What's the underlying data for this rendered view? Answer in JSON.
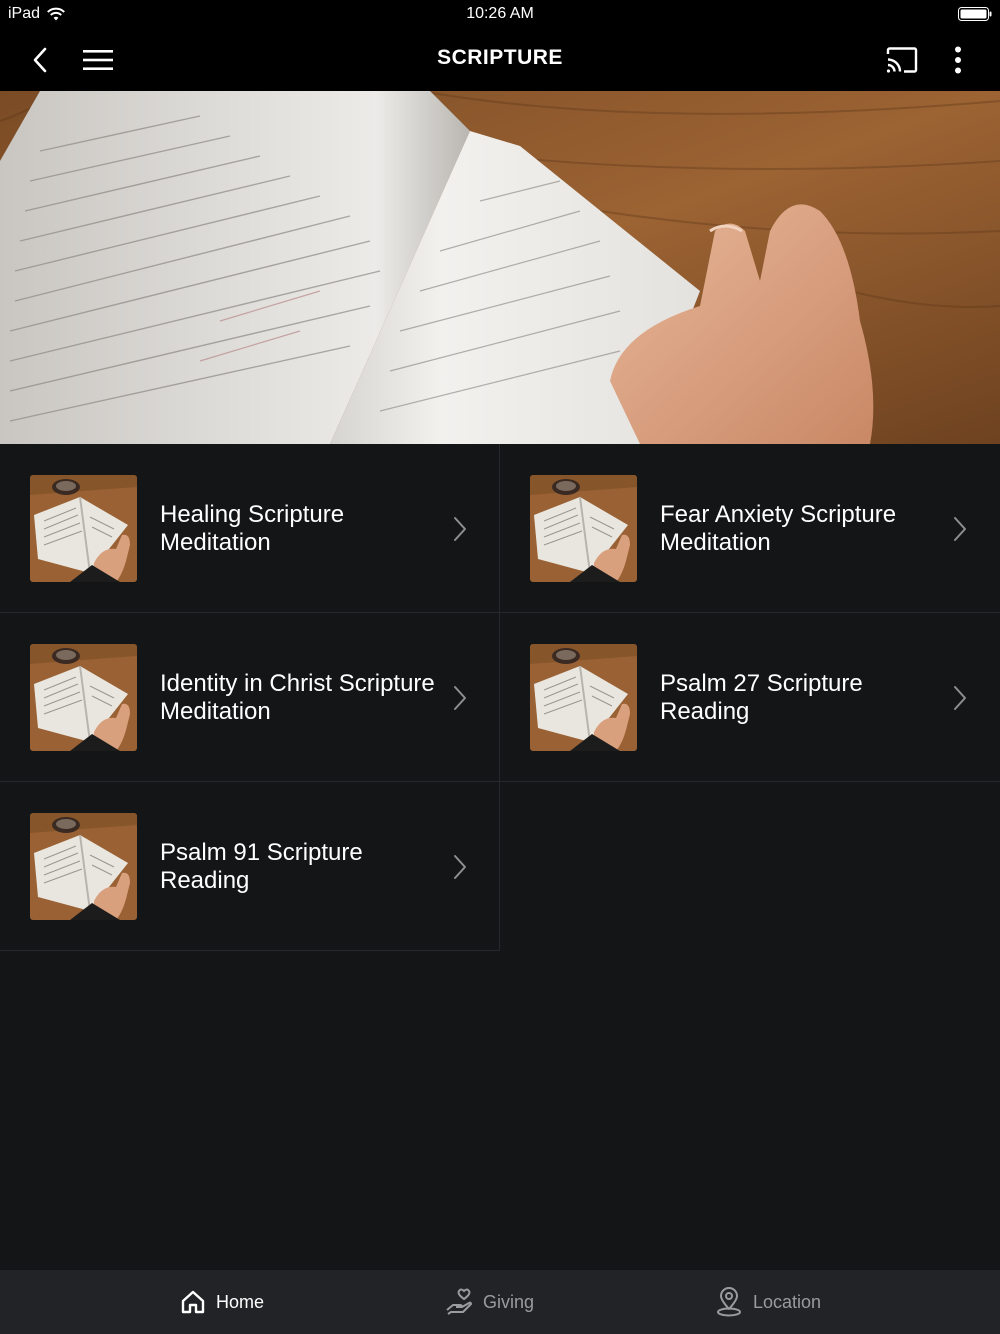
{
  "status": {
    "device": "iPad",
    "time": "10:26 AM"
  },
  "nav": {
    "title": "SCRIPTURE"
  },
  "items": [
    {
      "title": "Healing Scripture Meditation"
    },
    {
      "title": "Fear Anxiety Scripture Meditation"
    },
    {
      "title": "Identity in Christ Scripture Meditation"
    },
    {
      "title": "Psalm 27 Scripture Reading"
    },
    {
      "title": "Psalm 91 Scripture Reading"
    }
  ],
  "tabs": [
    {
      "label": "Home",
      "icon": "home-icon",
      "active": true
    },
    {
      "label": "Giving",
      "icon": "giving-hand-icon",
      "active": false
    },
    {
      "label": "Location",
      "icon": "location-pin-icon",
      "active": false
    }
  ],
  "colors": {
    "background": "#141517",
    "bar": "#000000",
    "tab_bar": "#222326",
    "inactive_tab": "#9a9b9d"
  }
}
